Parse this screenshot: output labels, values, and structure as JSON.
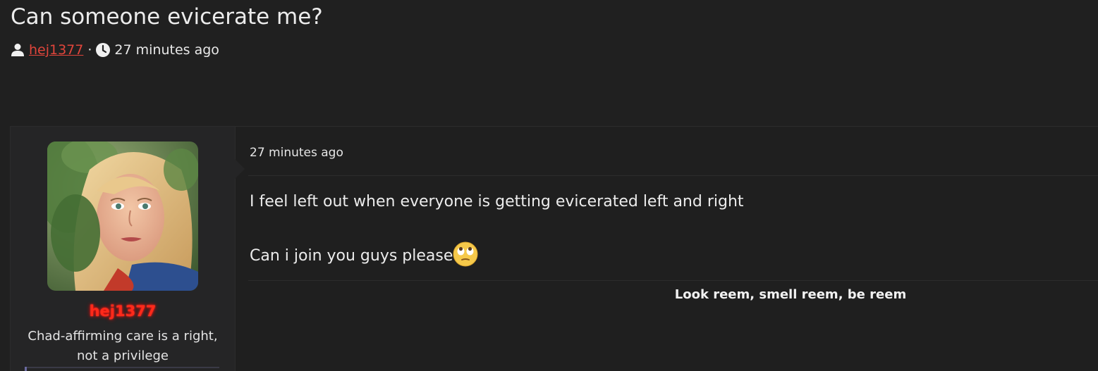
{
  "thread": {
    "title": "Can someone evicerate me?",
    "author": "hej1377",
    "separator": "·",
    "time_ago": "27 minutes ago"
  },
  "post": {
    "date": "27 minutes ago",
    "body_line_1": "I feel left out when everyone is getting evicerated left and right",
    "body_line_2": "Can i join you guys please",
    "emoji_icon": "face-with-rolling-eyes-icon",
    "signature": "Look reem, smell reem, be reem"
  },
  "user": {
    "name": "hej1377",
    "title": "Chad-affirming care is a right, not a privilege",
    "name_color": "#ff2a1a"
  },
  "colors": {
    "background": "#202020",
    "link": "#e0453b"
  }
}
